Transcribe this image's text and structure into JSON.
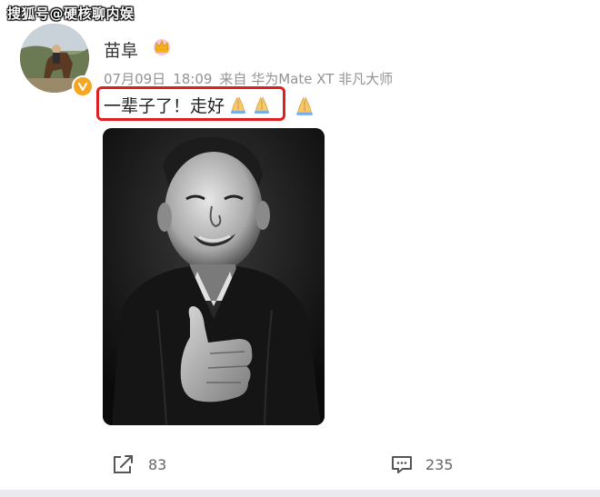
{
  "watermark": {
    "text": "搜狐号@硬核聊内娱"
  },
  "post": {
    "author": "苗阜",
    "date": "07月09日",
    "time": "18:09",
    "source": "来自 华为Mate XT 非凡大师",
    "text": "一辈子了！走好"
  },
  "actions": {
    "share_count": "83",
    "comment_count": "235"
  },
  "colors": {
    "highlight": "#e02020",
    "verified_badge": "#f5a623",
    "meta_text": "#939393"
  },
  "icons": {
    "verified": "verified-badge-icon",
    "crown": "crown-icon",
    "pray": "folded-hands-icon",
    "share": "share-icon",
    "comment": "comment-icon"
  }
}
